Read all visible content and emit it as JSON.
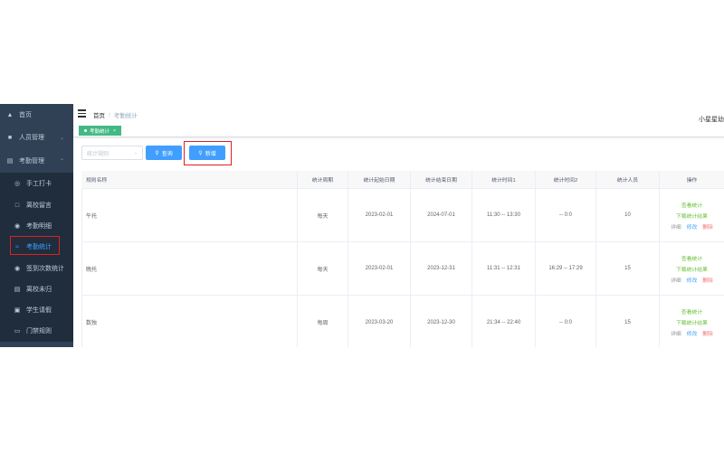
{
  "sidebar": {
    "items": [
      {
        "label": "首页",
        "icon": "dashboard-icon"
      },
      {
        "label": "人员管理",
        "icon": "user-icon"
      },
      {
        "label": "考勤管理",
        "icon": "calendar-icon"
      }
    ],
    "sub_items": [
      {
        "label": "手工打卡",
        "icon": "fingerprint-icon"
      },
      {
        "label": "离校留言",
        "icon": "message-icon"
      },
      {
        "label": "考勤明细",
        "icon": "location-icon"
      },
      {
        "label": "考勤统计",
        "icon": "chart-icon",
        "active": true
      },
      {
        "label": "签到次数统计",
        "icon": "count-icon"
      },
      {
        "label": "离校未归",
        "icon": "exit-icon"
      },
      {
        "label": "学生请假",
        "icon": "leave-icon"
      },
      {
        "label": "门禁规则",
        "icon": "door-icon"
      }
    ]
  },
  "header": {
    "breadcrumb_home": "首页",
    "breadcrumb_sep": "/",
    "breadcrumb_current": "考勤统计",
    "user_name": "小星星幼"
  },
  "tags": {
    "active_tag": "考勤统计",
    "close": "×"
  },
  "search": {
    "placeholder": "统计规则",
    "query_label": "查询",
    "add_label": "新增"
  },
  "table": {
    "headers": [
      "规则名称",
      "统计周期",
      "统计起始日期",
      "统计结束日期",
      "统计时间1",
      "统计时间2",
      "统计人员",
      "操作"
    ],
    "rows": [
      {
        "name": "午托",
        "period": "每天",
        "start": "2023-02-01",
        "end": "2024-07-01",
        "time1": "11:30 -- 13:30",
        "time2": "-- 0:0",
        "people": "10"
      },
      {
        "name": "晚托",
        "period": "每天",
        "start": "2023-02-01",
        "end": "2023-12-31",
        "time1": "11:31 -- 12:31",
        "time2": "16:29 -- 17:29",
        "people": "15"
      },
      {
        "name": "数独",
        "period": "每周",
        "start": "2023-03-20",
        "end": "2023-12-30",
        "time1": "21:34 -- 22:40",
        "time2": "-- 0:0",
        "people": "15"
      }
    ],
    "ops": {
      "view": "查看统计",
      "download": "下载统计结果",
      "detail": "详细",
      "edit": "修改",
      "delete": "删除"
    }
  },
  "colors": {
    "sidebar_bg": "#304156",
    "primary": "#409eff",
    "success": "#67c23a",
    "danger": "#f56c6c",
    "tag_green": "#42b983",
    "highlight_red": "#e02020"
  }
}
